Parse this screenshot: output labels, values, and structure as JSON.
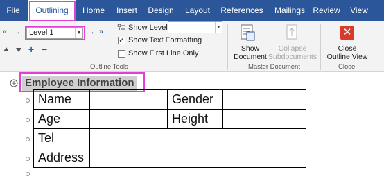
{
  "tabs": [
    {
      "label": "File"
    },
    {
      "label": "Outlining"
    },
    {
      "label": "Home"
    },
    {
      "label": "Insert"
    },
    {
      "label": "Design"
    },
    {
      "label": "Layout"
    },
    {
      "label": "References"
    },
    {
      "label": "Mailings"
    },
    {
      "label": "Review"
    },
    {
      "label": "View"
    }
  ],
  "outline_tools": {
    "group_label": "Outline Tools",
    "level_value": "Level 1",
    "show_level_label": "Show Level:",
    "show_level_value": "",
    "show_text_formatting_label": "Show Text Formatting",
    "show_text_formatting_checked": true,
    "show_first_line_only_label": "Show First Line Only",
    "show_first_line_only_checked": false
  },
  "master_document": {
    "group_label": "Master Document",
    "show_document_label_1": "Show",
    "show_document_label_2": "Document",
    "collapse_label_1": "Collapse",
    "collapse_label_2": "Subdocuments"
  },
  "close_group": {
    "group_label": "Close",
    "close_label_1": "Close",
    "close_label_2": "Outline View"
  },
  "document": {
    "heading": "Employee Information",
    "table": [
      [
        "Name",
        "",
        "Gender",
        ""
      ],
      [
        "Age",
        "",
        "Height",
        ""
      ],
      [
        "Tel",
        ""
      ],
      [
        "Address",
        ""
      ]
    ]
  },
  "colors": {
    "ribbon_tab_bar": "#2b579a",
    "highlight": "#e03fd8",
    "promote_arrow": "#2b9a3e",
    "close_button": "#d83b2b"
  }
}
